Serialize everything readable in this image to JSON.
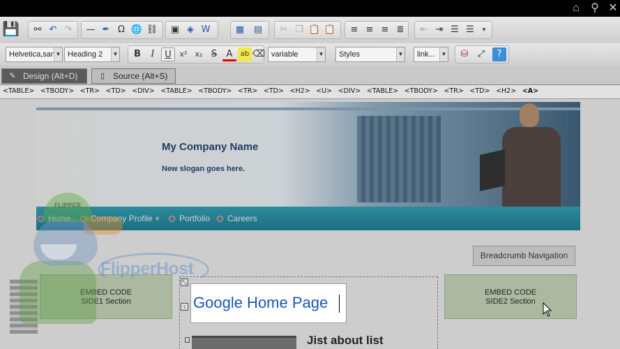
{
  "top_icons": [
    "home-icon",
    "search-icon",
    "close-icon"
  ],
  "toolbar": {
    "font_family": "Helvetica,sans-",
    "heading": "Heading 2",
    "font_size": "variable",
    "styles": "Styles",
    "links": "link..."
  },
  "modes": {
    "design": "Design (Alt+D)",
    "source": "Source (Alt+S)"
  },
  "tag_path": [
    "<TABLE>",
    "<TBODY>",
    "<TR>",
    "<TD>",
    "<DIV>",
    "<TABLE>",
    "<TBODY>",
    "<TR>",
    "<TD>",
    "<H2>",
    "<U>",
    "<DIV>",
    "<TABLE>",
    "<TBODY>",
    "<TR>",
    "<TD>",
    "<H2>",
    "<A>"
  ],
  "page": {
    "company_name": "My Company Name",
    "slogan": "New slogan goes here.",
    "nav": [
      "Home",
      "Company Profile +",
      "Portfolio",
      "Careers"
    ],
    "breadcrumb_button": "Breadcrumb Navigation",
    "embed_side1_line1": "EMBED CODE",
    "embed_side1_line2": "SIDE1 Section",
    "embed_side2_line1": "EMBED CODE",
    "embed_side2_line2": "SIDE2 Section",
    "link_text": "Google Home Page",
    "article_heading": "Jist about list"
  },
  "watermark": {
    "brand": "FlipperHost",
    "cap_text": "FLIPPER"
  },
  "colors": {
    "nav_bar": "#1c6e80",
    "link": "#1a56b5",
    "company_text": "#1f3c66",
    "embed_box": "#acb9a0"
  }
}
